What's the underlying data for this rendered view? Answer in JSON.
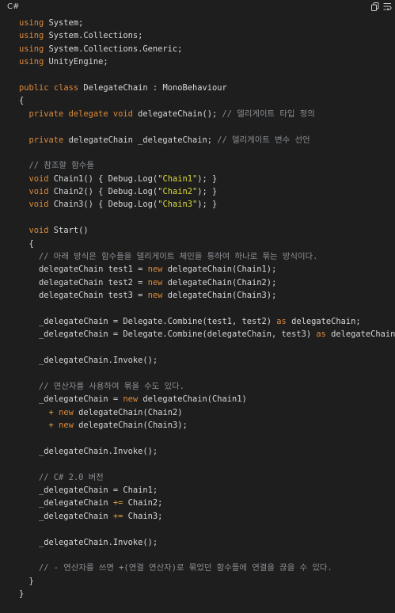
{
  "header": {
    "language": "C#",
    "copy_icon": "copy-icon",
    "wrap_icon": "wrap-lines-icon"
  },
  "colors": {
    "background": "#1e1e1e",
    "keyword": "#dd8a3a",
    "string": "#dcdc3c",
    "comment": "#8b8f94",
    "text": "#d4d4d4"
  },
  "code_lines": [
    [
      [
        "kw",
        "using"
      ],
      [
        "plain",
        " System;"
      ]
    ],
    [
      [
        "kw",
        "using"
      ],
      [
        "plain",
        " System.Collections;"
      ]
    ],
    [
      [
        "kw",
        "using"
      ],
      [
        "plain",
        " System.Collections.Generic;"
      ]
    ],
    [
      [
        "kw",
        "using"
      ],
      [
        "plain",
        " UnityEngine;"
      ]
    ],
    [],
    [
      [
        "kw",
        "public"
      ],
      [
        "plain",
        " "
      ],
      [
        "kw",
        "class"
      ],
      [
        "plain",
        " DelegateChain : MonoBehaviour"
      ]
    ],
    [
      [
        "plain",
        "{"
      ]
    ],
    [
      [
        "plain",
        "  "
      ],
      [
        "kw",
        "private"
      ],
      [
        "plain",
        " "
      ],
      [
        "kw",
        "delegate"
      ],
      [
        "plain",
        " "
      ],
      [
        "kw",
        "void"
      ],
      [
        "plain",
        " delegateChain(); "
      ],
      [
        "cm",
        "// 델리게이트 타입 정의"
      ]
    ],
    [],
    [
      [
        "plain",
        "  "
      ],
      [
        "kw",
        "private"
      ],
      [
        "plain",
        " delegateChain _delegateChain; "
      ],
      [
        "cm",
        "// 델리게이트 변수 선언"
      ]
    ],
    [],
    [
      [
        "plain",
        "  "
      ],
      [
        "cm",
        "// 참조할 함수들"
      ]
    ],
    [
      [
        "plain",
        "  "
      ],
      [
        "kw",
        "void"
      ],
      [
        "plain",
        " Chain1() { Debug.Log("
      ],
      [
        "str",
        "\"Chain1\""
      ],
      [
        "plain",
        "); }"
      ]
    ],
    [
      [
        "plain",
        "  "
      ],
      [
        "kw",
        "void"
      ],
      [
        "plain",
        " Chain2() { Debug.Log("
      ],
      [
        "str",
        "\"Chain2\""
      ],
      [
        "plain",
        "); }"
      ]
    ],
    [
      [
        "plain",
        "  "
      ],
      [
        "kw",
        "void"
      ],
      [
        "plain",
        " Chain3() { Debug.Log("
      ],
      [
        "str",
        "\"Chain3\""
      ],
      [
        "plain",
        "); }"
      ]
    ],
    [],
    [
      [
        "plain",
        "  "
      ],
      [
        "kw",
        "void"
      ],
      [
        "plain",
        " Start()"
      ]
    ],
    [
      [
        "plain",
        "  {"
      ]
    ],
    [
      [
        "plain",
        "    "
      ],
      [
        "cm",
        "// 아래 방식은 함수들을 델리게이트 체인을 통하여 하나로 묶는 방식이다."
      ]
    ],
    [
      [
        "plain",
        "    delegateChain test1 = "
      ],
      [
        "kw",
        "new"
      ],
      [
        "plain",
        " delegateChain(Chain1);"
      ]
    ],
    [
      [
        "plain",
        "    delegateChain test2 = "
      ],
      [
        "kw",
        "new"
      ],
      [
        "plain",
        " delegateChain(Chain2);"
      ]
    ],
    [
      [
        "plain",
        "    delegateChain test3 = "
      ],
      [
        "kw",
        "new"
      ],
      [
        "plain",
        " delegateChain(Chain3);"
      ]
    ],
    [],
    [
      [
        "plain",
        "    _delegateChain = Delegate.Combine(test1, test2) "
      ],
      [
        "kw",
        "as"
      ],
      [
        "plain",
        " delegateChain;"
      ]
    ],
    [
      [
        "plain",
        "    _delegateChain = Delegate.Combine(delegateChain, test3) "
      ],
      [
        "kw",
        "as"
      ],
      [
        "plain",
        " delegateChain;"
      ]
    ],
    [],
    [
      [
        "plain",
        "    _delegateChain.Invoke();"
      ]
    ],
    [],
    [
      [
        "plain",
        "    "
      ],
      [
        "cm",
        "// 연산자를 사용하여 묶을 수도 있다."
      ]
    ],
    [
      [
        "plain",
        "    _delegateChain = "
      ],
      [
        "kw",
        "new"
      ],
      [
        "plain",
        " delegateChain(Chain1)"
      ]
    ],
    [
      [
        "plain",
        "      "
      ],
      [
        "op",
        "+"
      ],
      [
        "plain",
        " "
      ],
      [
        "kw",
        "new"
      ],
      [
        "plain",
        " delegateChain(Chain2)"
      ]
    ],
    [
      [
        "plain",
        "      "
      ],
      [
        "op",
        "+"
      ],
      [
        "plain",
        " "
      ],
      [
        "kw",
        "new"
      ],
      [
        "plain",
        " delegateChain(Chain3);"
      ]
    ],
    [],
    [
      [
        "plain",
        "    _delegateChain.Invoke();"
      ]
    ],
    [],
    [
      [
        "plain",
        "    "
      ],
      [
        "cm",
        "// C# 2.0 버전"
      ]
    ],
    [
      [
        "plain",
        "    _delegateChain = Chain1;"
      ]
    ],
    [
      [
        "plain",
        "    _delegateChain "
      ],
      [
        "op",
        "+="
      ],
      [
        "plain",
        " Chain2;"
      ]
    ],
    [
      [
        "plain",
        "    _delegateChain "
      ],
      [
        "op",
        "+="
      ],
      [
        "plain",
        " Chain3;"
      ]
    ],
    [],
    [
      [
        "plain",
        "    _delegateChain.Invoke();"
      ]
    ],
    [],
    [
      [
        "plain",
        "    "
      ],
      [
        "cm",
        "// - 연산자를 쓰면 +(연결 연산자)로 묶었던 함수들에 연결을 끊을 수 있다."
      ]
    ],
    [
      [
        "plain",
        "  }"
      ]
    ],
    [
      [
        "plain",
        "}"
      ]
    ]
  ]
}
